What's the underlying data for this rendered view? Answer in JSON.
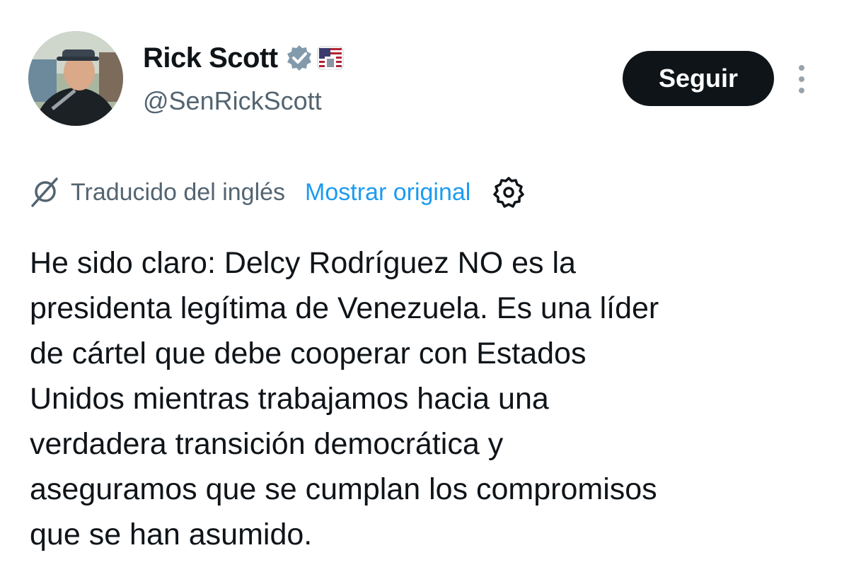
{
  "author": {
    "display_name": "Rick Scott",
    "handle": "@SenRickScott",
    "avatar": "avatar-photo",
    "badges": [
      "verified-badge-icon",
      "us-flag-badge-icon"
    ]
  },
  "actions": {
    "follow_label": "Seguir",
    "more_icon": "more-vertical-icon"
  },
  "translation": {
    "label": "Traducido del inglés",
    "show_original": "Mostrar original",
    "icon": "translate-icon",
    "settings_icon": "gear-icon"
  },
  "tweet": {
    "lines": [
      "He sido claro: Delcy Rodríguez NO es la",
      "presidenta legítima de Venezuela. Es una líder",
      "de cártel que debe cooperar con Estados",
      "Unidos mientras trabajamos hacia una",
      "verdadera transición democrática y",
      "aseguramos que se cumplan los compromisos",
      "que se han asumido."
    ]
  },
  "colors": {
    "text_primary": "#0f1419",
    "text_secondary": "#536471",
    "link": "#1d9bf0",
    "button_bg": "#0f1419",
    "verified_badge": "#829aab"
  }
}
